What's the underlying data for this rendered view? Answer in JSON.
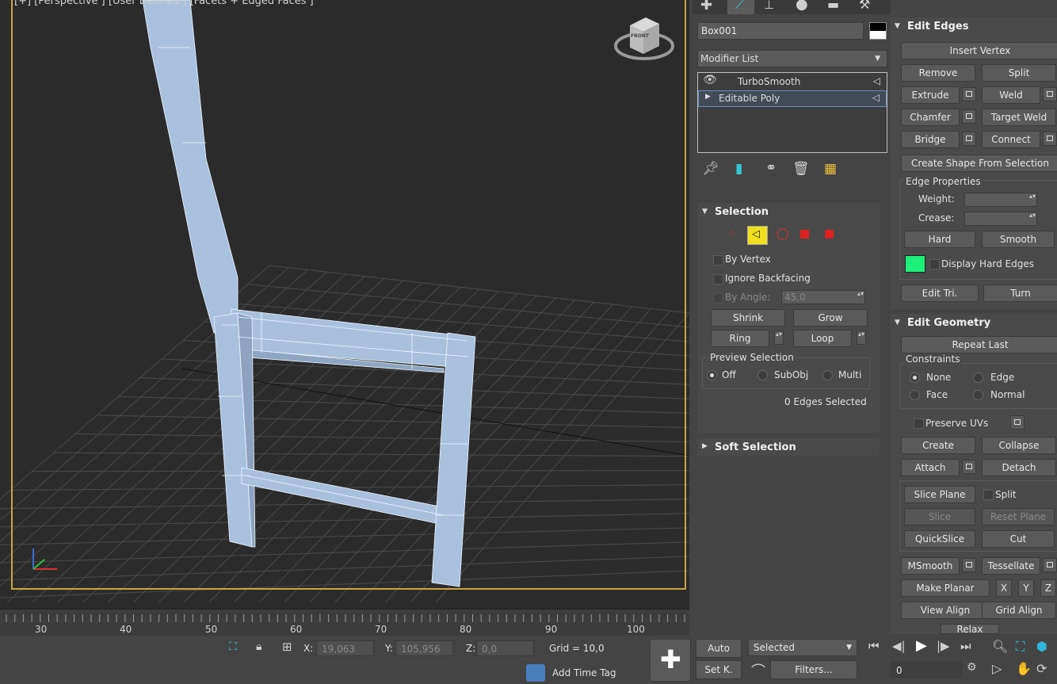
{
  "viewport": {
    "label": "[+] [Perspective ] [User Defined ] [Facets + Edged Faces ]",
    "viewcube_label": "FRONT"
  },
  "timeline": {
    "ticks": [
      "30",
      "40",
      "50",
      "60",
      "70",
      "80",
      "90",
      "100"
    ]
  },
  "status": {
    "x_label": "X:",
    "x_value": "19,063",
    "y_label": "Y:",
    "y_value": "105,956",
    "z_label": "Z:",
    "z_value": "0,0",
    "grid": "Grid = 10,0",
    "add_time_tag": "Add Time Tag"
  },
  "anim": {
    "auto": "Auto",
    "set_key": "Set K.",
    "selected": "Selected",
    "filters": "Filters...",
    "frame": "0"
  },
  "modifier": {
    "object_name": "Box001",
    "modifier_list": "Modifier List",
    "stack": [
      "TurboSmooth",
      "Editable Poly"
    ],
    "colors": {
      "swatch_top": "#000000",
      "swatch_bottom": "#ffffff"
    }
  },
  "selection": {
    "title": "Selection",
    "by_vertex": "By Vertex",
    "ignore_backfacing": "Ignore Backfacing",
    "by_angle": "By Angle:",
    "angle_value": "45,0",
    "shrink": "Shrink",
    "grow": "Grow",
    "ring": "Ring",
    "loop": "Loop",
    "preview_title": "Preview Selection",
    "preview_off": "Off",
    "preview_subobj": "SubObj",
    "preview_multi": "Multi",
    "status": "0 Edges Selected"
  },
  "soft_selection": {
    "title": "Soft Selection"
  },
  "edit_edges": {
    "title": "Edit Edges",
    "insert_vertex": "Insert Vertex",
    "remove": "Remove",
    "split": "Split",
    "extrude": "Extrude",
    "weld": "Weld",
    "chamfer": "Chamfer",
    "target_weld": "Target Weld",
    "bridge": "Bridge",
    "connect": "Connect",
    "create_shape": "Create Shape From Selection",
    "edge_props": "Edge Properties",
    "weight": "Weight:",
    "crease": "Crease:",
    "hard": "Hard",
    "smooth": "Smooth",
    "display_hard_edges": "Display Hard Edges",
    "hard_edge_color": "#1cf07a",
    "edit_tri": "Edit Tri.",
    "turn": "Turn"
  },
  "edit_geometry": {
    "title": "Edit Geometry",
    "repeat_last": "Repeat Last",
    "constraints": "Constraints",
    "none": "None",
    "edge": "Edge",
    "face": "Face",
    "normal": "Normal",
    "preserve_uvs": "Preserve UVs",
    "create": "Create",
    "collapse": "Collapse",
    "attach": "Attach",
    "detach": "Detach",
    "slice_plane": "Slice Plane",
    "split": "Split",
    "slice": "Slice",
    "reset_plane": "Reset Plane",
    "quickslice": "QuickSlice",
    "cut": "Cut",
    "msmooth": "MSmooth",
    "tessellate": "Tessellate",
    "make_planar": "Make Planar",
    "x": "X",
    "y": "Y",
    "z": "Z",
    "view_align": "View Align",
    "grid_align": "Grid Align",
    "relax": "Relax"
  }
}
